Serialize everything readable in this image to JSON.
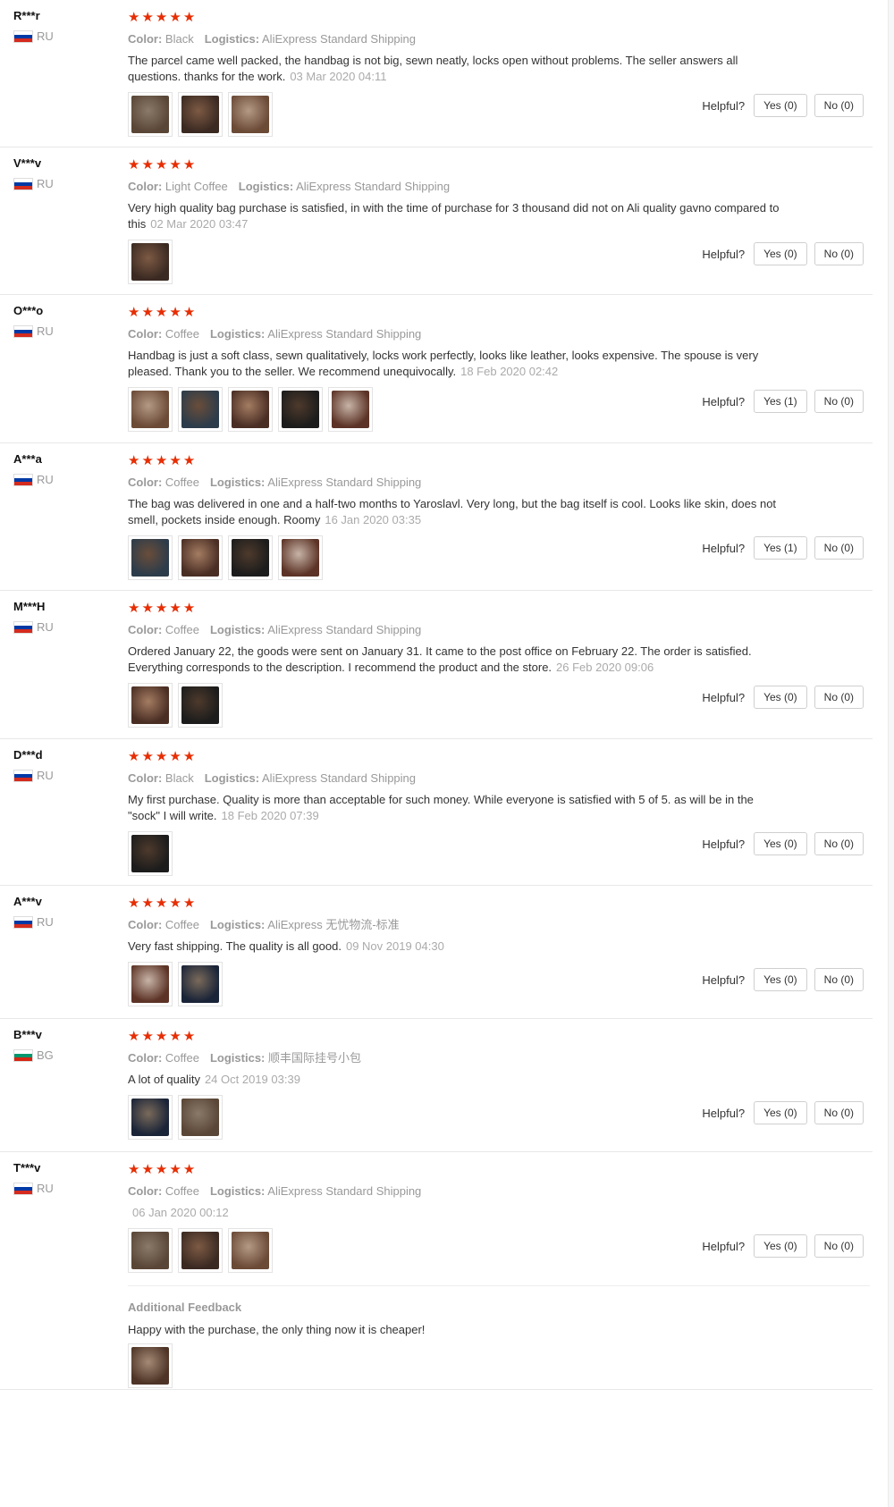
{
  "labels": {
    "color": "Color:",
    "logistics": "Logistics:",
    "helpful": "Helpful?",
    "additional_feedback": "Additional Feedback"
  },
  "star_glyph": "★",
  "colors": {
    "star": "#e62e04",
    "muted": "#999999"
  },
  "reviews": [
    {
      "user": "R***r",
      "country": "RU",
      "rating": 5,
      "color": "Black",
      "logistics": "AliExpress Standard Shipping",
      "text": "The parcel came well packed, the handbag is not big, sewn neatly, locks open without problems. The seller answers all questions. thanks for the work.",
      "date": "03 Mar 2020 04:11",
      "yes": "Yes (0)",
      "no": "No (0)",
      "photos": 3
    },
    {
      "user": "V***v",
      "country": "RU",
      "rating": 5,
      "color": "Light Coffee",
      "logistics": "AliExpress Standard Shipping",
      "text": "Very high quality bag purchase is satisfied, in with the time of purchase for 3 thousand did not on Ali quality gavno compared to this",
      "date": "02 Mar 2020 03:47",
      "yes": "Yes (0)",
      "no": "No (0)",
      "photos": 1
    },
    {
      "user": "O***o",
      "country": "RU",
      "rating": 5,
      "color": "Coffee",
      "logistics": "AliExpress Standard Shipping",
      "text": "Handbag is just a soft class, sewn qualitatively, locks work perfectly, looks like leather, looks expensive. The spouse is very pleased. Thank you to the seller. We recommend unequivocally.",
      "date": "18 Feb 2020 02:42",
      "yes": "Yes (1)",
      "no": "No (0)",
      "photos": 5
    },
    {
      "user": "A***a",
      "country": "RU",
      "rating": 5,
      "color": "Coffee",
      "logistics": "AliExpress Standard Shipping",
      "text": "The bag was delivered in one and a half-two months to Yaroslavl. Very long, but the bag itself is cool. Looks like skin, does not smell, pockets inside enough. Roomy",
      "date": "16 Jan 2020 03:35",
      "yes": "Yes (1)",
      "no": "No (0)",
      "photos": 4
    },
    {
      "user": "M***H",
      "country": "RU",
      "rating": 5,
      "color": "Coffee",
      "logistics": "AliExpress Standard Shipping",
      "text": "Ordered January 22, the goods were sent on January 31. It came to the post office on February 22. The order is satisfied. Everything corresponds to the description. I recommend the product and the store.",
      "date": "26 Feb 2020 09:06",
      "yes": "Yes (0)",
      "no": "No (0)",
      "photos": 2
    },
    {
      "user": "D***d",
      "country": "RU",
      "rating": 5,
      "color": "Black",
      "logistics": "AliExpress Standard Shipping",
      "text": "My first purchase. Quality is more than acceptable for such money. While everyone is satisfied with 5 of 5. as will be in the \"sock\" I will write.",
      "date": "18 Feb 2020 07:39",
      "yes": "Yes (0)",
      "no": "No (0)",
      "photos": 1
    },
    {
      "user": "A***v",
      "country": "RU",
      "rating": 5,
      "color": "Coffee",
      "logistics": "AliExpress 无忧物流-标准",
      "text": "Very fast shipping. The quality is all good.",
      "date": "09 Nov 2019 04:30",
      "yes": "Yes (0)",
      "no": "No (0)",
      "photos": 2
    },
    {
      "user": "B***v",
      "country": "BG",
      "rating": 5,
      "color": "Coffee",
      "logistics": "顺丰国际挂号小包",
      "text": "A lot of quality",
      "date": "24 Oct 2019 03:39",
      "yes": "Yes (0)",
      "no": "No (0)",
      "photos": 2
    },
    {
      "user": "T***v",
      "country": "RU",
      "rating": 5,
      "color": "Coffee",
      "logistics": "AliExpress Standard Shipping",
      "text": "",
      "date": "06 Jan 2020 00:12",
      "yes": "Yes (0)",
      "no": "No (0)",
      "photos": 3,
      "additional": {
        "text": "Happy with the purchase, the only thing now it is cheaper!",
        "photos": 1
      }
    }
  ]
}
